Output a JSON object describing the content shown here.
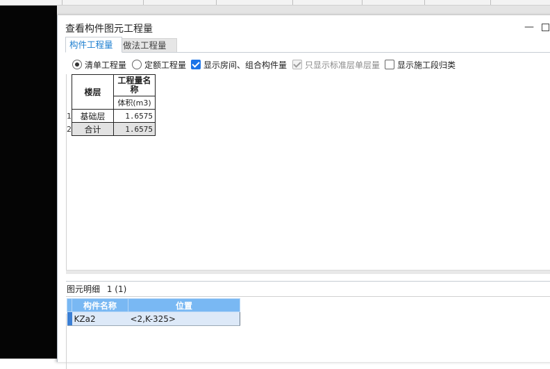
{
  "dialog": {
    "title": "查看构件图元工程量",
    "minimize_glyph": "—"
  },
  "tabs": [
    {
      "label": "构件工程量",
      "active": true
    },
    {
      "label": "做法工程量",
      "active": false
    }
  ],
  "options": {
    "radio_bill": {
      "label": "清单工程量",
      "checked": true
    },
    "radio_quota": {
      "label": "定额工程量",
      "checked": false
    },
    "check_room": {
      "label": "显示房间、组合构件量",
      "checked": true
    },
    "check_standard": {
      "label": "只显示标准层单层量",
      "checked": true,
      "disabled": true
    },
    "check_segment": {
      "label": "显示施工段归类",
      "checked": false
    }
  },
  "quantity_table": {
    "floor_header": "楼层",
    "qty_header": "工程量名称",
    "unit_header": "体积(m3)",
    "rows": [
      {
        "index": "1",
        "floor": "基础层",
        "volume": "1.6575"
      },
      {
        "index": "2",
        "floor": "合计",
        "volume": "1.6575"
      }
    ]
  },
  "detail": {
    "title": "图元明细",
    "count": "1 (1)",
    "headers": {
      "name": "构件名称",
      "position": "位置"
    },
    "rows": [
      {
        "name": "KZa2",
        "position": "<2,K-325>"
      }
    ]
  },
  "colors": {
    "accent": "#1e7fd0",
    "detail_header": "#79b8f3",
    "detail_row": "#dde9f8",
    "checkbox": "#1a73e8"
  }
}
